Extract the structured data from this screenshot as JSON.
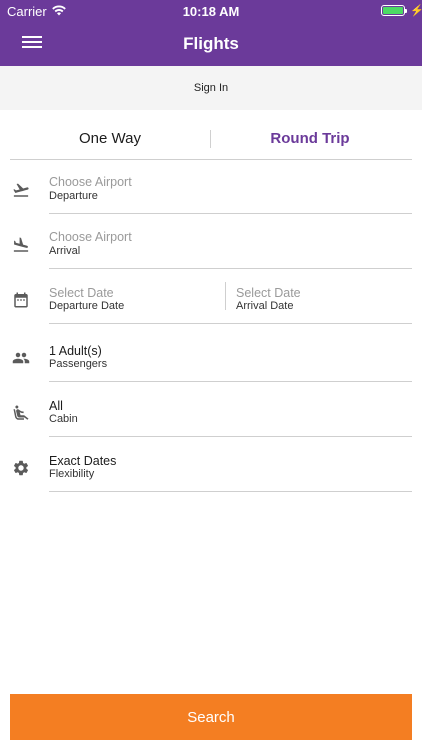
{
  "status": {
    "carrier": "Carrier",
    "time": "10:18 AM"
  },
  "nav": {
    "title": "Flights",
    "menu_icon": "hamburger-menu-icon"
  },
  "signin": {
    "label": "Sign In"
  },
  "tabs": {
    "one_way": "One Way",
    "round_trip": "Round Trip",
    "active": "round_trip"
  },
  "form": {
    "departure": {
      "placeholder": "Choose Airport",
      "label": "Departure",
      "icon": "flight-takeoff-icon"
    },
    "arrival": {
      "placeholder": "Choose Airport",
      "label": "Arrival",
      "icon": "flight-land-icon"
    },
    "dates": {
      "icon": "calendar-icon",
      "departure": {
        "placeholder": "Select Date",
        "label": "Departure Date"
      },
      "arrival": {
        "placeholder": "Select Date",
        "label": "Arrival Date"
      }
    },
    "passengers": {
      "value": "1 Adult(s)",
      "label": "Passengers",
      "icon": "people-icon"
    },
    "cabin": {
      "value": "All",
      "label": "Cabin",
      "icon": "seat-icon"
    },
    "flexibility": {
      "value": "Exact Dates",
      "label": "Flexibility",
      "icon": "gear-icon"
    }
  },
  "search": {
    "label": "Search"
  },
  "colors": {
    "brand": "#6b3a9a",
    "accent": "#f47e22"
  }
}
